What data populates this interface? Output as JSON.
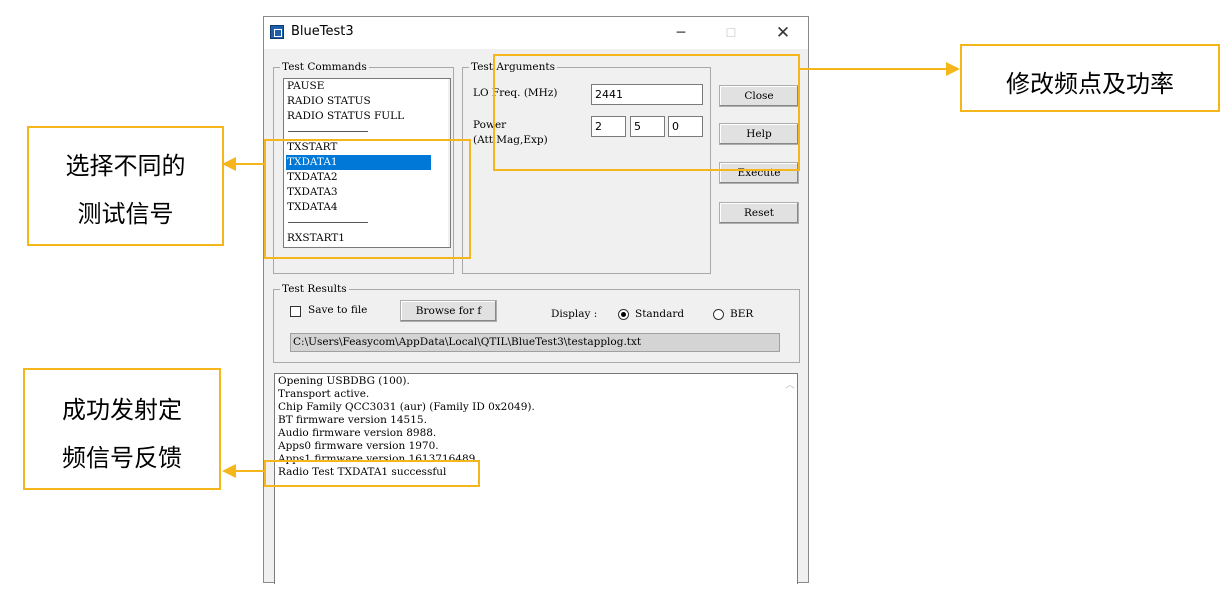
{
  "window": {
    "title": "BlueTest3",
    "controls": {
      "minimize": "─",
      "maximize": "☐",
      "close": "✕"
    }
  },
  "test_commands": {
    "legend": "Test Commands",
    "items": [
      "PAUSE",
      "RADIO STATUS",
      "RADIO STATUS FULL",
      "TXSTART",
      "TXDATA1",
      "TXDATA2",
      "TXDATA3",
      "TXDATA4",
      "RXSTART1"
    ],
    "selected": "TXDATA1"
  },
  "test_arguments": {
    "legend": "Test Arguments",
    "lo_freq_label": "LO Freq. (MHz)",
    "lo_freq_value": "2441",
    "power_label": "Power",
    "power_sublabel": "(Att,Mag,Exp)",
    "power_att": "2",
    "power_mag": "5",
    "power_exp": "0"
  },
  "buttons": {
    "close": "Close",
    "help": "Help",
    "execute": "Execute",
    "reset": "Reset"
  },
  "test_results": {
    "legend": "Test Results",
    "save_to_file_label": "Save to file",
    "save_to_file_checked": false,
    "browse_label": "Browse for f",
    "display_label": "Display :",
    "standard_label": "Standard",
    "ber_label": "BER",
    "selected_display": "Standard",
    "log_path": "C:\\Users\\Feasycom\\AppData\\Local\\QTIL\\BlueTest3\\testapplog.txt"
  },
  "log": [
    "Opening USBDBG (100).",
    "Transport active.",
    "Chip Family QCC3031 (aur) (Family ID 0x2049).",
    "BT firmware version 14515.",
    "Audio firmware version 8988.",
    "Apps0 firmware version 1970.",
    "Apps1 firmware version 1613716489.",
    "Radio Test TXDATA1 successful"
  ],
  "annotations": {
    "freq_power": "修改频点及功率",
    "select_signal": [
      "选择不同的",
      "测试信号"
    ],
    "tx_feedback": [
      "成功发射定",
      "频信号反馈"
    ],
    "color": "#f4b61a"
  }
}
